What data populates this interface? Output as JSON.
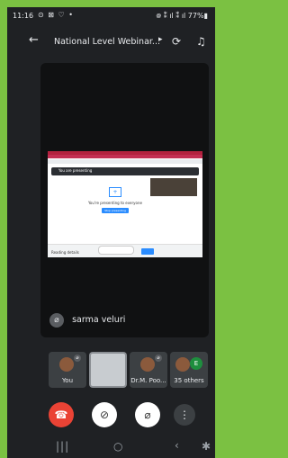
{
  "statusbar": {
    "time": "11:16",
    "notifications": "⊙ ⊠ ♡ •",
    "right": "᪤ ⁑ ıl ⁑ ıl 77%▮"
  },
  "appbar": {
    "back_icon": "arrow-back-icon",
    "title": "National Level Webinar...",
    "chevron": "▸",
    "switch_camera_icon": "switch-camera-icon",
    "audio_output_icon": "headphones-icon"
  },
  "main": {
    "presenting_text": "You are presenting",
    "presenting_center": "You're presenting to everyone",
    "stop_button": "Stop presenting",
    "bottom_text": "Reading details",
    "speaker_name": "sarma veluri"
  },
  "tiles": [
    {
      "label": "You",
      "type": "avatar"
    },
    {
      "label": "",
      "type": "video"
    },
    {
      "label": "Dr.M. Poo...",
      "type": "avatar"
    },
    {
      "label": "35 others",
      "type": "group",
      "initial": "E"
    }
  ],
  "controls": {
    "end_call_icon": "end-call-icon",
    "camera_off_icon": "camera-off-icon",
    "mic_off_icon": "mic-off-icon",
    "more_icon": "more-vert-icon"
  },
  "colors": {
    "border": "#7bc142",
    "background": "#1f2124",
    "end_call": "#ea4335",
    "accent": "#2a8cff"
  }
}
